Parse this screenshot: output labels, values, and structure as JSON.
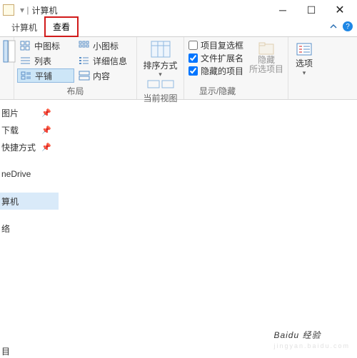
{
  "titlebar": {
    "separator": "▾ |",
    "title": "计算机"
  },
  "tabs": {
    "computer": "计算机",
    "view": "查看"
  },
  "ribbon": {
    "layout": {
      "medium_icons": "中图标",
      "small_icons": "小图标",
      "list": "列表",
      "details": "详细信息",
      "tiles": "平铺",
      "content": "内容",
      "group_label": "布局"
    },
    "sort": {
      "label": "排序方式",
      "group_label": "当前视图"
    },
    "show": {
      "checkboxes": "项目复选框",
      "extensions": "文件扩展名",
      "hidden": "隐藏的项目",
      "hide_btn": "隐藏\n所选项目",
      "group_label": "显示/隐藏"
    },
    "options": {
      "label": "选项"
    }
  },
  "sidebar": {
    "items": [
      {
        "label": "图片",
        "pinned": true
      },
      {
        "label": "下载",
        "pinned": true
      },
      {
        "label": "快捷方式",
        "pinned": true
      },
      {
        "label": "neDrive",
        "pinned": false
      },
      {
        "label": "算机",
        "pinned": false,
        "selected": true
      },
      {
        "label": "络",
        "pinned": false
      }
    ]
  },
  "statusbar": {
    "text": "目"
  },
  "watermark": {
    "main": "Baidu 经验",
    "sub": "jingyan.baidu.com"
  }
}
